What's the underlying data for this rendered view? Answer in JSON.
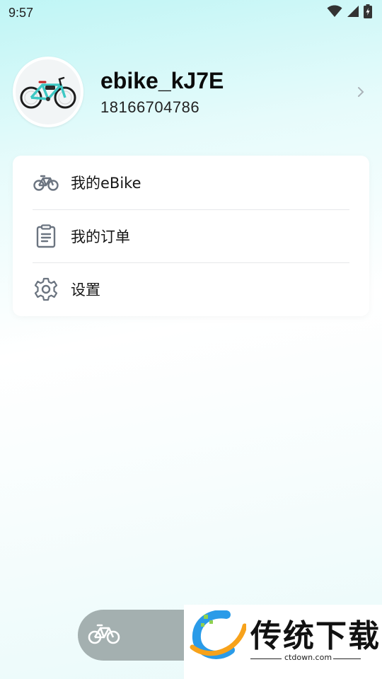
{
  "status_bar": {
    "time": "9:57",
    "icons": [
      "wifi-icon",
      "cell-signal-icon",
      "battery-charging-icon"
    ]
  },
  "profile": {
    "username": "ebike_kJ7E",
    "phone": "18166704786",
    "avatar": "bike-avatar",
    "chevron": "chevron-right-icon"
  },
  "menu": {
    "items": [
      {
        "label": "我的eBike",
        "icon": "bike-icon"
      },
      {
        "label": "我的订单",
        "icon": "clipboard-icon"
      },
      {
        "label": "设置",
        "icon": "gear-icon"
      }
    ]
  },
  "bottom_tab": {
    "icon": "bike-icon"
  },
  "watermark": {
    "text": "传统下载",
    "url": "ctdown.com"
  },
  "colors": {
    "accent": "#b8f3f3",
    "bike_frame": "#3ec8c4",
    "icon_gray": "#6b7480",
    "tab_pill": "#a4b0b0"
  }
}
